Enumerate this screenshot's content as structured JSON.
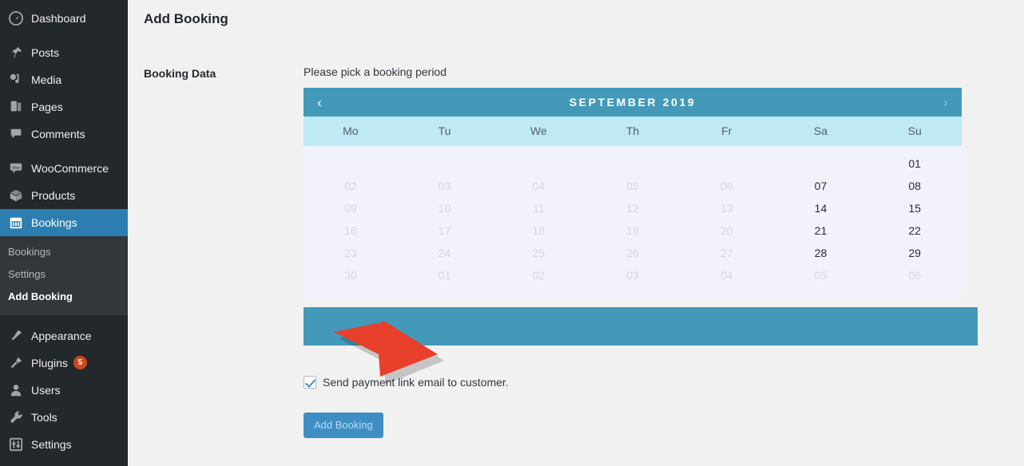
{
  "sidebar": {
    "items": [
      {
        "label": "Dashboard",
        "icon": "dashboard-icon",
        "active": false
      },
      {
        "label": "Posts",
        "icon": "pin-icon",
        "active": false
      },
      {
        "label": "Media",
        "icon": "media-icon",
        "active": false
      },
      {
        "label": "Pages",
        "icon": "pages-icon",
        "active": false
      },
      {
        "label": "Comments",
        "icon": "comments-icon",
        "active": false
      },
      {
        "label": "WooCommerce",
        "icon": "woocommerce-icon",
        "active": false
      },
      {
        "label": "Products",
        "icon": "products-box-icon",
        "active": false
      },
      {
        "label": "Bookings",
        "icon": "calendar-icon",
        "active": true
      },
      {
        "label": "Appearance",
        "icon": "paintbrush-icon",
        "active": false
      },
      {
        "label": "Plugins",
        "icon": "plug-icon",
        "active": false,
        "badge": "5"
      },
      {
        "label": "Users",
        "icon": "user-icon",
        "active": false
      },
      {
        "label": "Tools",
        "icon": "wrench-icon",
        "active": false
      },
      {
        "label": "Settings",
        "icon": "sliders-icon",
        "active": false
      }
    ],
    "submenu": [
      {
        "label": "Bookings",
        "current": false
      },
      {
        "label": "Settings",
        "current": false
      },
      {
        "label": "Add Booking",
        "current": true
      }
    ]
  },
  "page": {
    "title": "Add Booking",
    "section_label": "Booking Data",
    "pick_text": "Please pick a booking period"
  },
  "calendar": {
    "prev_icon": "chevron-left-icon",
    "next_icon": "chevron-right-icon",
    "prev_glyph": "‹",
    "next_glyph": "›",
    "month_title": "SEPTEMBER 2019",
    "weekdays": [
      "Mo",
      "Tu",
      "We",
      "Th",
      "Fr",
      "Sa",
      "Su"
    ],
    "weeks": [
      [
        {
          "label": "",
          "state": "blank"
        },
        {
          "label": "",
          "state": "blank"
        },
        {
          "label": "",
          "state": "blank"
        },
        {
          "label": "",
          "state": "blank"
        },
        {
          "label": "",
          "state": "blank"
        },
        {
          "label": "",
          "state": "blank"
        },
        {
          "label": "01",
          "state": "on"
        }
      ],
      [
        {
          "label": "02",
          "state": "off"
        },
        {
          "label": "03",
          "state": "off"
        },
        {
          "label": "04",
          "state": "off"
        },
        {
          "label": "05",
          "state": "off"
        },
        {
          "label": "06",
          "state": "off"
        },
        {
          "label": "07",
          "state": "on"
        },
        {
          "label": "08",
          "state": "on"
        }
      ],
      [
        {
          "label": "09",
          "state": "off"
        },
        {
          "label": "10",
          "state": "off"
        },
        {
          "label": "11",
          "state": "off"
        },
        {
          "label": "12",
          "state": "off"
        },
        {
          "label": "13",
          "state": "off"
        },
        {
          "label": "14",
          "state": "on"
        },
        {
          "label": "15",
          "state": "on"
        }
      ],
      [
        {
          "label": "16",
          "state": "off"
        },
        {
          "label": "17",
          "state": "off"
        },
        {
          "label": "18",
          "state": "off"
        },
        {
          "label": "19",
          "state": "off"
        },
        {
          "label": "20",
          "state": "off"
        },
        {
          "label": "21",
          "state": "on"
        },
        {
          "label": "22",
          "state": "on"
        }
      ],
      [
        {
          "label": "23",
          "state": "off"
        },
        {
          "label": "24",
          "state": "off"
        },
        {
          "label": "25",
          "state": "off"
        },
        {
          "label": "26",
          "state": "off"
        },
        {
          "label": "27",
          "state": "off"
        },
        {
          "label": "28",
          "state": "on"
        },
        {
          "label": "29",
          "state": "on"
        }
      ],
      [
        {
          "label": "30",
          "state": "off"
        },
        {
          "label": "01",
          "state": "off"
        },
        {
          "label": "02",
          "state": "off"
        },
        {
          "label": "03",
          "state": "off"
        },
        {
          "label": "04",
          "state": "off"
        },
        {
          "label": "05",
          "state": "off"
        },
        {
          "label": "06",
          "state": "off"
        }
      ]
    ]
  },
  "form": {
    "checkbox_label": "Send payment link email to customer.",
    "checkbox_checked": true,
    "submit_label": "Add Booking"
  },
  "annotation": {
    "shape": "arrow-pointing-right",
    "color": "#e8402a"
  },
  "colors": {
    "sidebar_bg": "#23282d",
    "sidebar_submenu_bg": "#32373c",
    "sidebar_active": "#2c7eb0",
    "calendar_header": "#4499b8",
    "calendar_weekdays": "#bee9f5",
    "calendar_body": "#f2f2fd",
    "button": "#3e8ec4",
    "badge": "#ca4a1f",
    "annotation_red": "#e8402a"
  }
}
